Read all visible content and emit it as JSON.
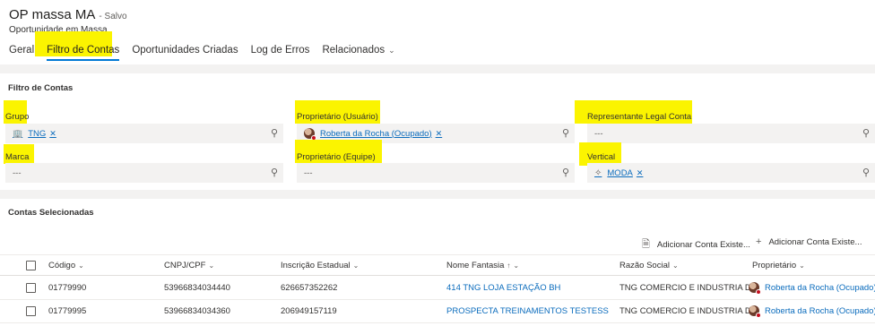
{
  "header": {
    "title": "OP massa MA",
    "saved": "- Salvo",
    "entity": "Oportunidade em Massa"
  },
  "tabs": [
    {
      "label": "Geral"
    },
    {
      "label": "Filtro de Contas"
    },
    {
      "label": "Oportunidades Criadas"
    },
    {
      "label": "Log de Erros"
    },
    {
      "label": "Relacionados"
    }
  ],
  "filter": {
    "section_title": "Filtro de Contas",
    "grupo": {
      "label": "Grupo",
      "value": "TNG"
    },
    "proprietario_usuario": {
      "label": "Proprietário (Usuário)",
      "value": "Roberta da Rocha (Ocupado)"
    },
    "representante": {
      "label": "Representante Legal Conta",
      "value": "---"
    },
    "marca": {
      "label": "Marca",
      "value": "---"
    },
    "proprietario_equipe": {
      "label": "Proprietário (Equipe)",
      "value": "---"
    },
    "vertical": {
      "label": "Vertical",
      "value": "MODA"
    }
  },
  "grid": {
    "title": "Contas Selecionadas",
    "commands": {
      "add_existing_1": "Adicionar Conta Existe...",
      "add_existing_2": "Adicionar Conta Existe..."
    },
    "columns": {
      "codigo": "Código",
      "cnpj": "CNPJ/CPF",
      "ie": "Inscrição Estadual",
      "fantasia": "Nome Fantasia",
      "razao": "Razão Social",
      "proprietario": "Proprietário"
    },
    "rows": [
      {
        "codigo": "01779990",
        "cnpj": "53966834034440",
        "ie": "626657352262",
        "fantasia": "414 TNG LOJA ESTAÇÃO BH",
        "razao": "TNG COMERCIO E INDUSTRIA D...",
        "proprietario": "Roberta da Rocha (Ocupado)"
      },
      {
        "codigo": "01779995",
        "cnpj": "53966834034360",
        "ie": "206949157119",
        "fantasia": "PROSPECTA TREINAMENTOS TESTESS",
        "razao": "TNG COMERCIO E INDUSTRIA D...",
        "proprietario": "Roberta da Rocha (Ocupado)"
      }
    ]
  },
  "colors": {
    "highlight": "#fbf400",
    "link": "#0b6cbd",
    "active_tab": "#0078d4"
  }
}
